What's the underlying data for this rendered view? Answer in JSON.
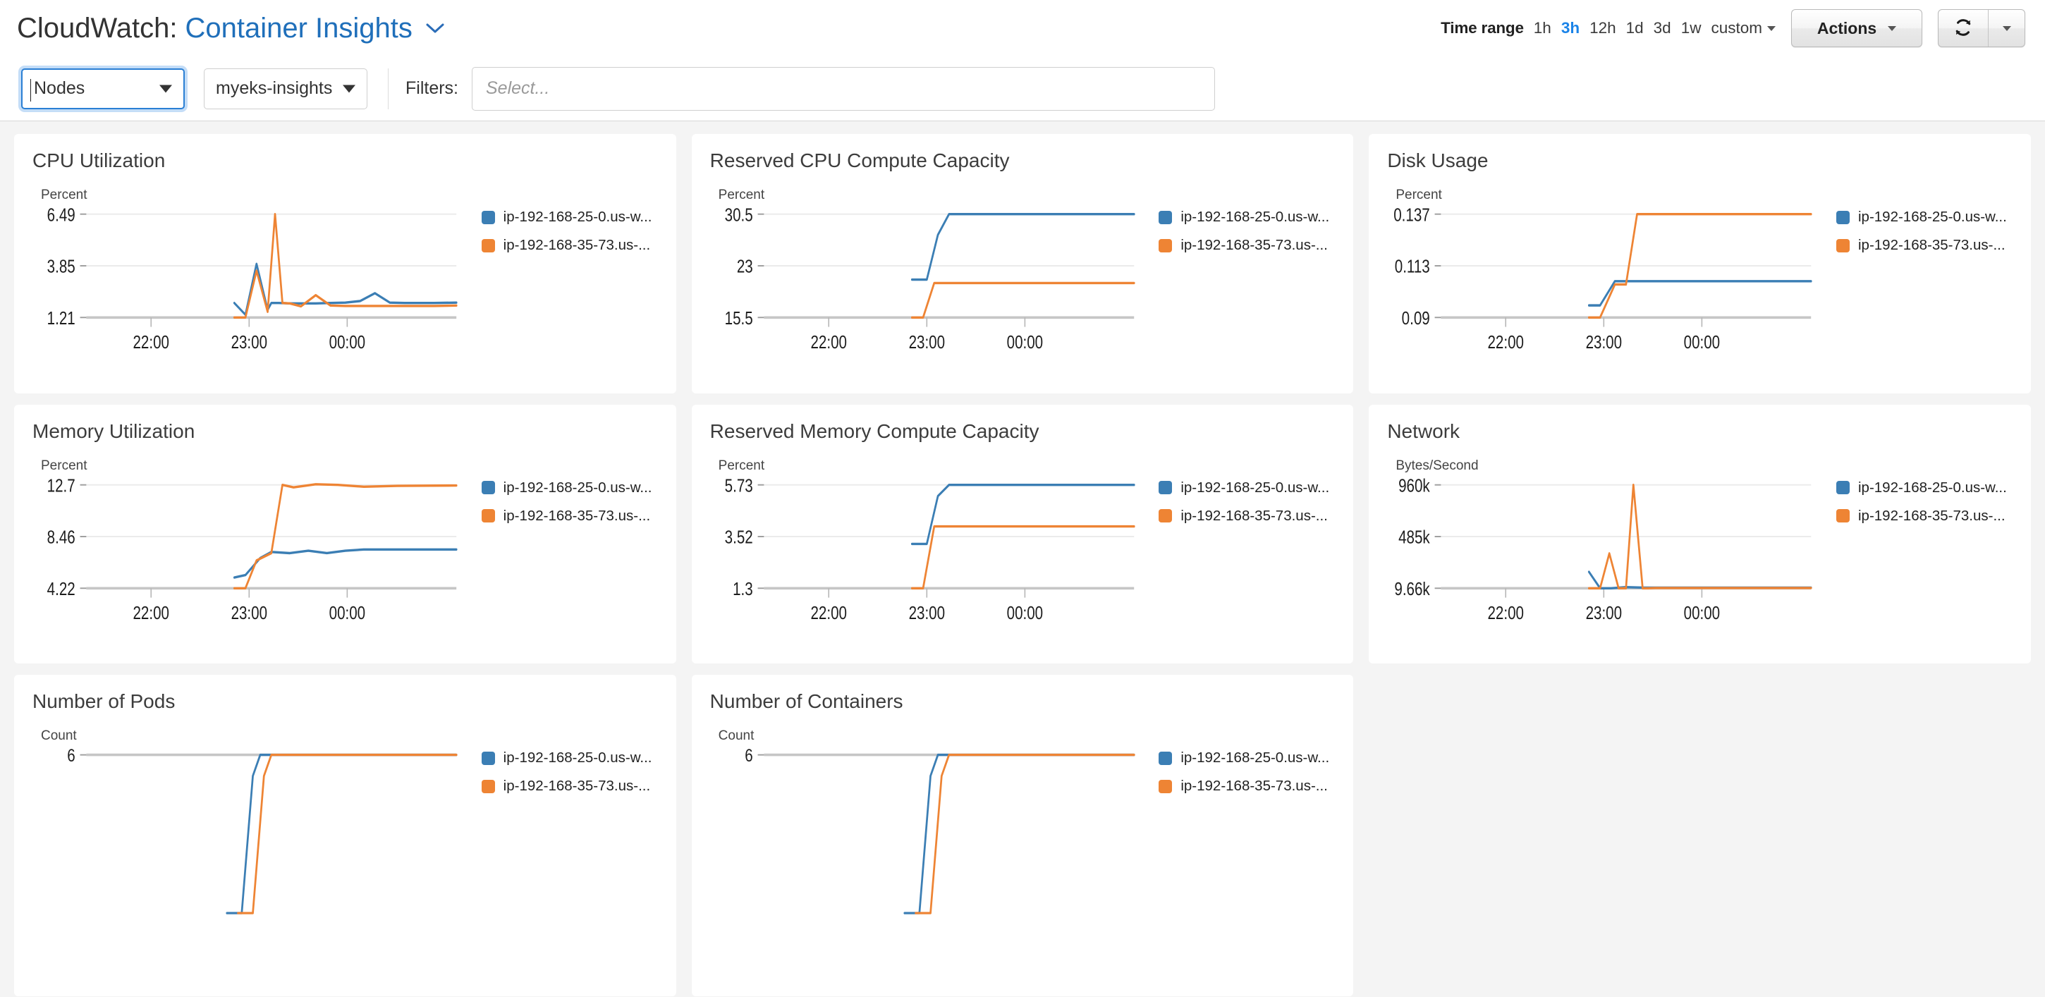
{
  "header": {
    "title_prefix": "CloudWatch:",
    "title_link": "Container Insights",
    "title_chevron_icon": "chevron-down-icon",
    "time_range_label": "Time range",
    "time_range_options": [
      "1h",
      "3h",
      "12h",
      "1d",
      "3d",
      "1w"
    ],
    "time_range_active": "3h",
    "custom_label": "custom",
    "actions_label": "Actions",
    "refresh_icon": "refresh-icon",
    "refresh_caret_icon": "caret-down-icon"
  },
  "filterbar": {
    "resource_select": {
      "value": "Nodes",
      "icon": "caret-down-icon"
    },
    "cluster_select": {
      "value": "myeks-insights",
      "icon": "caret-down-icon"
    },
    "filters_label": "Filters:",
    "filters_placeholder": "Select...",
    "filters_caret_icon": "caret-down-icon"
  },
  "colors": {
    "series_blue": "#3b7eb4",
    "series_orange": "#ee8434",
    "accent_link": "#1f6fba",
    "active_timerange": "#1a83e8",
    "card_bg": "#ffffff",
    "page_bg": "#f4f4f4",
    "axis_line": "#c6c6c6",
    "gridline": "#ebebeb"
  },
  "legend_series": [
    {
      "label": "ip-192-168-25-0.us-w...",
      "color": "#3b7eb4"
    },
    {
      "label": "ip-192-168-35-73.us-...",
      "color": "#ee8434"
    }
  ],
  "chart_data": [
    {
      "type": "line",
      "title": "CPU Utilization",
      "ylabel": "Percent",
      "xlabel": "",
      "yticks": [
        "1.21",
        "3.85",
        "6.49"
      ],
      "ylim": [
        1.21,
        6.49
      ],
      "xticks": [
        "22:00",
        "23:00",
        "00:00"
      ],
      "grid": true,
      "legend_position": "right",
      "series": [
        {
          "name": "ip-192-168-25-0.us-w...",
          "color": "#3b7eb4",
          "x": [
            0.4,
            0.43,
            0.46,
            0.49,
            0.5,
            0.52,
            0.55,
            0.58,
            0.62,
            0.66,
            0.7,
            0.74,
            0.78,
            0.82,
            0.86,
            0.9,
            0.94,
            1.0
          ],
          "values": [
            1.95,
            1.35,
            3.95,
            1.6,
            1.95,
            1.95,
            1.93,
            1.93,
            1.93,
            1.95,
            1.97,
            2.05,
            2.45,
            1.97,
            1.95,
            1.95,
            1.95,
            1.97
          ]
        },
        {
          "name": "ip-192-168-35-73.us-...",
          "color": "#ee8434",
          "x": [
            0.4,
            0.43,
            0.46,
            0.49,
            0.51,
            0.53,
            0.55,
            0.58,
            0.62,
            0.66,
            0.7,
            0.74,
            0.78,
            0.82,
            0.86,
            0.9,
            0.94,
            1.0
          ],
          "values": [
            1.21,
            1.21,
            3.6,
            1.5,
            6.49,
            1.95,
            1.93,
            1.78,
            2.35,
            1.82,
            1.8,
            1.8,
            1.8,
            1.8,
            1.8,
            1.8,
            1.8,
            1.82
          ]
        }
      ]
    },
    {
      "type": "line",
      "title": "Reserved CPU Compute Capacity",
      "ylabel": "Percent",
      "xlabel": "",
      "yticks": [
        "15.5",
        "23",
        "30.5"
      ],
      "ylim": [
        15.5,
        30.5
      ],
      "xticks": [
        "22:00",
        "23:00",
        "00:00"
      ],
      "grid": true,
      "legend_position": "right",
      "series": [
        {
          "name": "ip-192-168-25-0.us-w...",
          "color": "#3b7eb4",
          "x": [
            0.4,
            0.44,
            0.47,
            0.5,
            0.54,
            1.0
          ],
          "values": [
            21.0,
            21.0,
            27.5,
            30.5,
            30.5,
            30.5
          ]
        },
        {
          "name": "ip-192-168-35-73.us-...",
          "color": "#ee8434",
          "x": [
            0.4,
            0.43,
            0.46,
            0.5,
            1.0
          ],
          "values": [
            15.5,
            15.5,
            20.5,
            20.5,
            20.5
          ]
        }
      ]
    },
    {
      "type": "line",
      "title": "Disk Usage",
      "ylabel": "Percent",
      "xlabel": "",
      "yticks": [
        "0.09",
        "0.113",
        "0.137"
      ],
      "ylim": [
        0.09,
        0.137
      ],
      "xticks": [
        "22:00",
        "23:00",
        "00:00"
      ],
      "grid": true,
      "legend_position": "right",
      "series": [
        {
          "name": "ip-192-168-25-0.us-w...",
          "color": "#3b7eb4",
          "x": [
            0.4,
            0.43,
            0.47,
            0.5,
            1.0
          ],
          "values": [
            0.0955,
            0.0955,
            0.1065,
            0.1065,
            0.1065
          ]
        },
        {
          "name": "ip-192-168-35-73.us-...",
          "color": "#ee8434",
          "x": [
            0.4,
            0.43,
            0.47,
            0.5,
            0.53,
            1.0
          ],
          "values": [
            0.09,
            0.09,
            0.105,
            0.105,
            0.137,
            0.137
          ]
        }
      ]
    },
    {
      "type": "line",
      "title": "Memory Utilization",
      "ylabel": "Percent",
      "xlabel": "",
      "yticks": [
        "4.22",
        "8.46",
        "12.7"
      ],
      "ylim": [
        4.22,
        12.7
      ],
      "xticks": [
        "22:00",
        "23:00",
        "00:00"
      ],
      "grid": true,
      "legend_position": "right",
      "series": [
        {
          "name": "ip-192-168-25-0.us-w...",
          "color": "#3b7eb4",
          "x": [
            0.4,
            0.43,
            0.47,
            0.5,
            0.55,
            0.6,
            0.65,
            0.7,
            0.75,
            0.82,
            1.0
          ],
          "values": [
            5.1,
            5.3,
            6.7,
            7.2,
            7.1,
            7.3,
            7.1,
            7.3,
            7.4,
            7.4,
            7.4
          ]
        },
        {
          "name": "ip-192-168-35-73.us-...",
          "color": "#ee8434",
          "x": [
            0.4,
            0.43,
            0.46,
            0.5,
            0.53,
            0.56,
            0.62,
            0.68,
            0.75,
            0.84,
            1.0
          ],
          "values": [
            4.22,
            4.22,
            6.5,
            7.1,
            12.7,
            12.5,
            12.75,
            12.7,
            12.55,
            12.62,
            12.65
          ]
        }
      ]
    },
    {
      "type": "line",
      "title": "Reserved Memory Compute Capacity",
      "ylabel": "Percent",
      "xlabel": "",
      "yticks": [
        "1.3",
        "3.52",
        "5.73"
      ],
      "ylim": [
        1.3,
        5.73
      ],
      "xticks": [
        "22:00",
        "23:00",
        "00:00"
      ],
      "grid": true,
      "legend_position": "right",
      "series": [
        {
          "name": "ip-192-168-25-0.us-w...",
          "color": "#3b7eb4",
          "x": [
            0.4,
            0.44,
            0.47,
            0.5,
            1.0
          ],
          "values": [
            3.2,
            3.2,
            5.25,
            5.73,
            5.73
          ]
        },
        {
          "name": "ip-192-168-35-73.us-...",
          "color": "#ee8434",
          "x": [
            0.4,
            0.43,
            0.46,
            0.5,
            1.0
          ],
          "values": [
            1.3,
            1.3,
            3.95,
            3.95,
            3.95
          ]
        }
      ]
    },
    {
      "type": "line",
      "title": "Network",
      "ylabel": "Bytes/Second",
      "xlabel": "",
      "yticks": [
        "9.66k",
        "485k",
        "960k"
      ],
      "ylim": [
        9660,
        960000
      ],
      "xticks": [
        "22:00",
        "23:00",
        "00:00"
      ],
      "grid": true,
      "legend_position": "right",
      "series": [
        {
          "name": "ip-192-168-25-0.us-w...",
          "color": "#3b7eb4",
          "x": [
            0.4,
            0.43,
            0.46,
            0.5,
            0.55,
            1.0
          ],
          "values": [
            160000,
            9660,
            9660,
            20000,
            15000,
            15000
          ]
        },
        {
          "name": "ip-192-168-35-73.us-...",
          "color": "#ee8434",
          "x": [
            0.4,
            0.43,
            0.455,
            0.48,
            0.5,
            0.52,
            0.545,
            0.56,
            0.58,
            1.0
          ],
          "values": [
            9660,
            9660,
            330000,
            9660,
            9660,
            960000,
            9660,
            9660,
            12000,
            12000
          ]
        }
      ]
    },
    {
      "type": "line",
      "title": "Number of Pods",
      "ylabel": "Count",
      "xlabel": "",
      "yticks": [
        "6"
      ],
      "ylim": [
        0,
        6
      ],
      "xticks": [],
      "grid": true,
      "legend_position": "right",
      "series": [
        {
          "name": "ip-192-168-25-0.us-w...",
          "color": "#3b7eb4",
          "x": [
            0.38,
            0.42,
            0.45,
            0.47,
            1.0
          ],
          "values": [
            0,
            0,
            5.2,
            6,
            6
          ]
        },
        {
          "name": "ip-192-168-35-73.us-...",
          "color": "#ee8434",
          "x": [
            0.41,
            0.45,
            0.48,
            0.5,
            1.0
          ],
          "values": [
            0,
            0,
            5.2,
            6,
            6
          ]
        }
      ]
    },
    {
      "type": "line",
      "title": "Number of Containers",
      "ylabel": "Count",
      "xlabel": "",
      "yticks": [
        "6"
      ],
      "ylim": [
        0,
        6
      ],
      "xticks": [],
      "grid": true,
      "legend_position": "right",
      "series": [
        {
          "name": "ip-192-168-25-0.us-w...",
          "color": "#3b7eb4",
          "x": [
            0.38,
            0.42,
            0.45,
            0.47,
            1.0
          ],
          "values": [
            0,
            0,
            5.2,
            6,
            6
          ]
        },
        {
          "name": "ip-192-168-35-73.us-...",
          "color": "#ee8434",
          "x": [
            0.41,
            0.45,
            0.48,
            0.5,
            1.0
          ],
          "values": [
            0,
            0,
            5.2,
            6,
            6
          ]
        }
      ]
    }
  ]
}
